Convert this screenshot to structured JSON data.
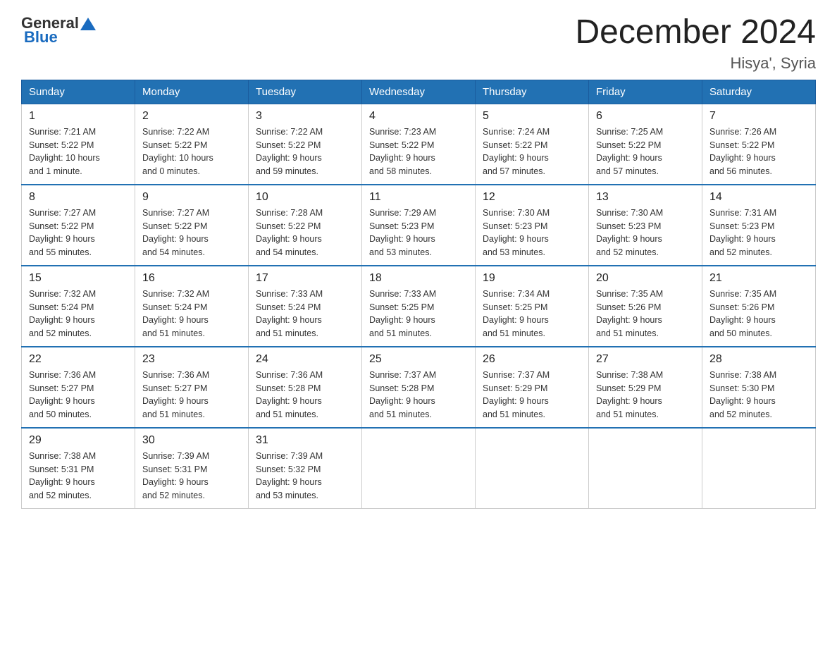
{
  "logo": {
    "text_general": "General",
    "text_blue": "Blue"
  },
  "title": "December 2024",
  "location": "Hisya', Syria",
  "days_of_week": [
    "Sunday",
    "Monday",
    "Tuesday",
    "Wednesday",
    "Thursday",
    "Friday",
    "Saturday"
  ],
  "weeks": [
    [
      {
        "day": "1",
        "sunrise": "7:21 AM",
        "sunset": "5:22 PM",
        "daylight": "10 hours and 1 minute."
      },
      {
        "day": "2",
        "sunrise": "7:22 AM",
        "sunset": "5:22 PM",
        "daylight": "10 hours and 0 minutes."
      },
      {
        "day": "3",
        "sunrise": "7:22 AM",
        "sunset": "5:22 PM",
        "daylight": "9 hours and 59 minutes."
      },
      {
        "day": "4",
        "sunrise": "7:23 AM",
        "sunset": "5:22 PM",
        "daylight": "9 hours and 58 minutes."
      },
      {
        "day": "5",
        "sunrise": "7:24 AM",
        "sunset": "5:22 PM",
        "daylight": "9 hours and 57 minutes."
      },
      {
        "day": "6",
        "sunrise": "7:25 AM",
        "sunset": "5:22 PM",
        "daylight": "9 hours and 57 minutes."
      },
      {
        "day": "7",
        "sunrise": "7:26 AM",
        "sunset": "5:22 PM",
        "daylight": "9 hours and 56 minutes."
      }
    ],
    [
      {
        "day": "8",
        "sunrise": "7:27 AM",
        "sunset": "5:22 PM",
        "daylight": "9 hours and 55 minutes."
      },
      {
        "day": "9",
        "sunrise": "7:27 AM",
        "sunset": "5:22 PM",
        "daylight": "9 hours and 54 minutes."
      },
      {
        "day": "10",
        "sunrise": "7:28 AM",
        "sunset": "5:22 PM",
        "daylight": "9 hours and 54 minutes."
      },
      {
        "day": "11",
        "sunrise": "7:29 AM",
        "sunset": "5:23 PM",
        "daylight": "9 hours and 53 minutes."
      },
      {
        "day": "12",
        "sunrise": "7:30 AM",
        "sunset": "5:23 PM",
        "daylight": "9 hours and 53 minutes."
      },
      {
        "day": "13",
        "sunrise": "7:30 AM",
        "sunset": "5:23 PM",
        "daylight": "9 hours and 52 minutes."
      },
      {
        "day": "14",
        "sunrise": "7:31 AM",
        "sunset": "5:23 PM",
        "daylight": "9 hours and 52 minutes."
      }
    ],
    [
      {
        "day": "15",
        "sunrise": "7:32 AM",
        "sunset": "5:24 PM",
        "daylight": "9 hours and 52 minutes."
      },
      {
        "day": "16",
        "sunrise": "7:32 AM",
        "sunset": "5:24 PM",
        "daylight": "9 hours and 51 minutes."
      },
      {
        "day": "17",
        "sunrise": "7:33 AM",
        "sunset": "5:24 PM",
        "daylight": "9 hours and 51 minutes."
      },
      {
        "day": "18",
        "sunrise": "7:33 AM",
        "sunset": "5:25 PM",
        "daylight": "9 hours and 51 minutes."
      },
      {
        "day": "19",
        "sunrise": "7:34 AM",
        "sunset": "5:25 PM",
        "daylight": "9 hours and 51 minutes."
      },
      {
        "day": "20",
        "sunrise": "7:35 AM",
        "sunset": "5:26 PM",
        "daylight": "9 hours and 51 minutes."
      },
      {
        "day": "21",
        "sunrise": "7:35 AM",
        "sunset": "5:26 PM",
        "daylight": "9 hours and 50 minutes."
      }
    ],
    [
      {
        "day": "22",
        "sunrise": "7:36 AM",
        "sunset": "5:27 PM",
        "daylight": "9 hours and 50 minutes."
      },
      {
        "day": "23",
        "sunrise": "7:36 AM",
        "sunset": "5:27 PM",
        "daylight": "9 hours and 51 minutes."
      },
      {
        "day": "24",
        "sunrise": "7:36 AM",
        "sunset": "5:28 PM",
        "daylight": "9 hours and 51 minutes."
      },
      {
        "day": "25",
        "sunrise": "7:37 AM",
        "sunset": "5:28 PM",
        "daylight": "9 hours and 51 minutes."
      },
      {
        "day": "26",
        "sunrise": "7:37 AM",
        "sunset": "5:29 PM",
        "daylight": "9 hours and 51 minutes."
      },
      {
        "day": "27",
        "sunrise": "7:38 AM",
        "sunset": "5:29 PM",
        "daylight": "9 hours and 51 minutes."
      },
      {
        "day": "28",
        "sunrise": "7:38 AM",
        "sunset": "5:30 PM",
        "daylight": "9 hours and 52 minutes."
      }
    ],
    [
      {
        "day": "29",
        "sunrise": "7:38 AM",
        "sunset": "5:31 PM",
        "daylight": "9 hours and 52 minutes."
      },
      {
        "day": "30",
        "sunrise": "7:39 AM",
        "sunset": "5:31 PM",
        "daylight": "9 hours and 52 minutes."
      },
      {
        "day": "31",
        "sunrise": "7:39 AM",
        "sunset": "5:32 PM",
        "daylight": "9 hours and 53 minutes."
      },
      null,
      null,
      null,
      null
    ]
  ],
  "labels": {
    "sunrise": "Sunrise:",
    "sunset": "Sunset:",
    "daylight": "Daylight:"
  }
}
